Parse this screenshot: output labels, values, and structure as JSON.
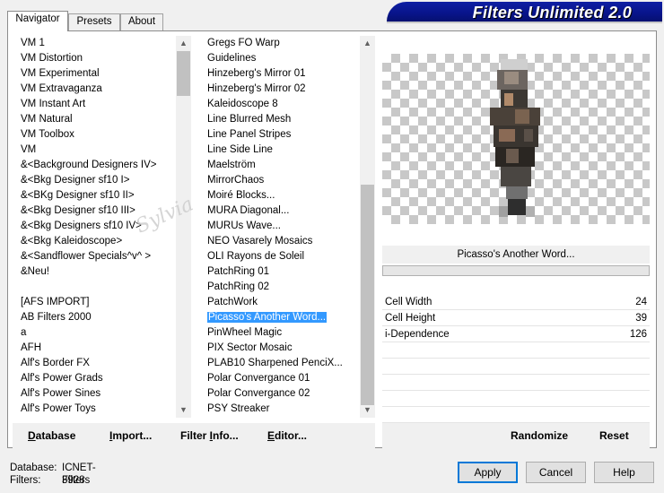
{
  "window": {
    "title": "Filters Unlimited 2.0"
  },
  "tabs": [
    {
      "label": "Navigator",
      "active": true
    },
    {
      "label": "Presets",
      "active": false
    },
    {
      "label": "About",
      "active": false
    }
  ],
  "categories": [
    "VM 1",
    "VM Distortion",
    "VM Experimental",
    "VM Extravaganza",
    "VM Instant Art",
    "VM Natural",
    "VM Toolbox",
    "VM",
    "&<Background Designers IV>",
    "&<Bkg Designer sf10 I>",
    "&<BKg Designer sf10 II>",
    "&<Bkg Designer sf10 III>",
    "&<Bkg Designers sf10 IV>",
    "&<Bkg Kaleidoscope>",
    "&<Sandflower Specials^v^ >",
    "&Neu!",
    "",
    "[AFS IMPORT]",
    "AB Filters 2000",
    "a",
    "AFH",
    "Alf's Border FX",
    "Alf's Power Grads",
    "Alf's Power Sines",
    "Alf's Power Toys"
  ],
  "filters": {
    "items": [
      "Gregs FO Warp",
      "Guidelines",
      "Hinzeberg's Mirror 01",
      "Hinzeberg's Mirror 02",
      "Kaleidoscope 8",
      "Line Blurred Mesh",
      "Line Panel Stripes",
      "Line Side Line",
      "Maelström",
      "MirrorChaos",
      "Moiré Blocks...",
      "MURA Diagonal...",
      "MURUs Wave...",
      "NEO Vasarely Mosaics",
      "OLI Rayons de Soleil",
      "PatchRing 01",
      "PatchRing 02",
      "PatchWork",
      "Picasso's Another Word...",
      "PinWheel Magic",
      "PIX Sector Mosaic",
      "PLAB10 Sharpened PenciX...",
      "Polar Convergance 01",
      "Polar Convergance 02",
      "PSY Streaker"
    ],
    "selected_index": 18
  },
  "selected_filter": {
    "name": "Picasso's Another Word..."
  },
  "parameters": [
    {
      "label": "Cell Width",
      "value": "24"
    },
    {
      "label": "Cell Height",
      "value": "39"
    },
    {
      "label": "i-Dependence",
      "value": "126"
    }
  ],
  "watermark": "Sylvia",
  "actions": {
    "database": {
      "label": "atabase",
      "accel": "D"
    },
    "import": {
      "label": "mport...",
      "accel": "I"
    },
    "filter_info": {
      "label": "Filter ",
      "accel": "I",
      "rest": "nfo..."
    },
    "editor": {
      "label": "ditor...",
      "accel": "E"
    },
    "randomize": "Randomize",
    "reset": "Reset"
  },
  "status": {
    "database_label": "Database:",
    "database_value": "ICNET-Filters",
    "filters_label": "Filters:",
    "filters_value": "3928"
  },
  "buttons": {
    "apply": "Apply",
    "cancel": "Cancel",
    "help": "Help"
  },
  "colors": {
    "banner": "#08148a",
    "selection": "#3399ff",
    "default_button_border": "#0078d7"
  },
  "icons": {
    "scroll_up": "▲",
    "scroll_down": "▼"
  }
}
